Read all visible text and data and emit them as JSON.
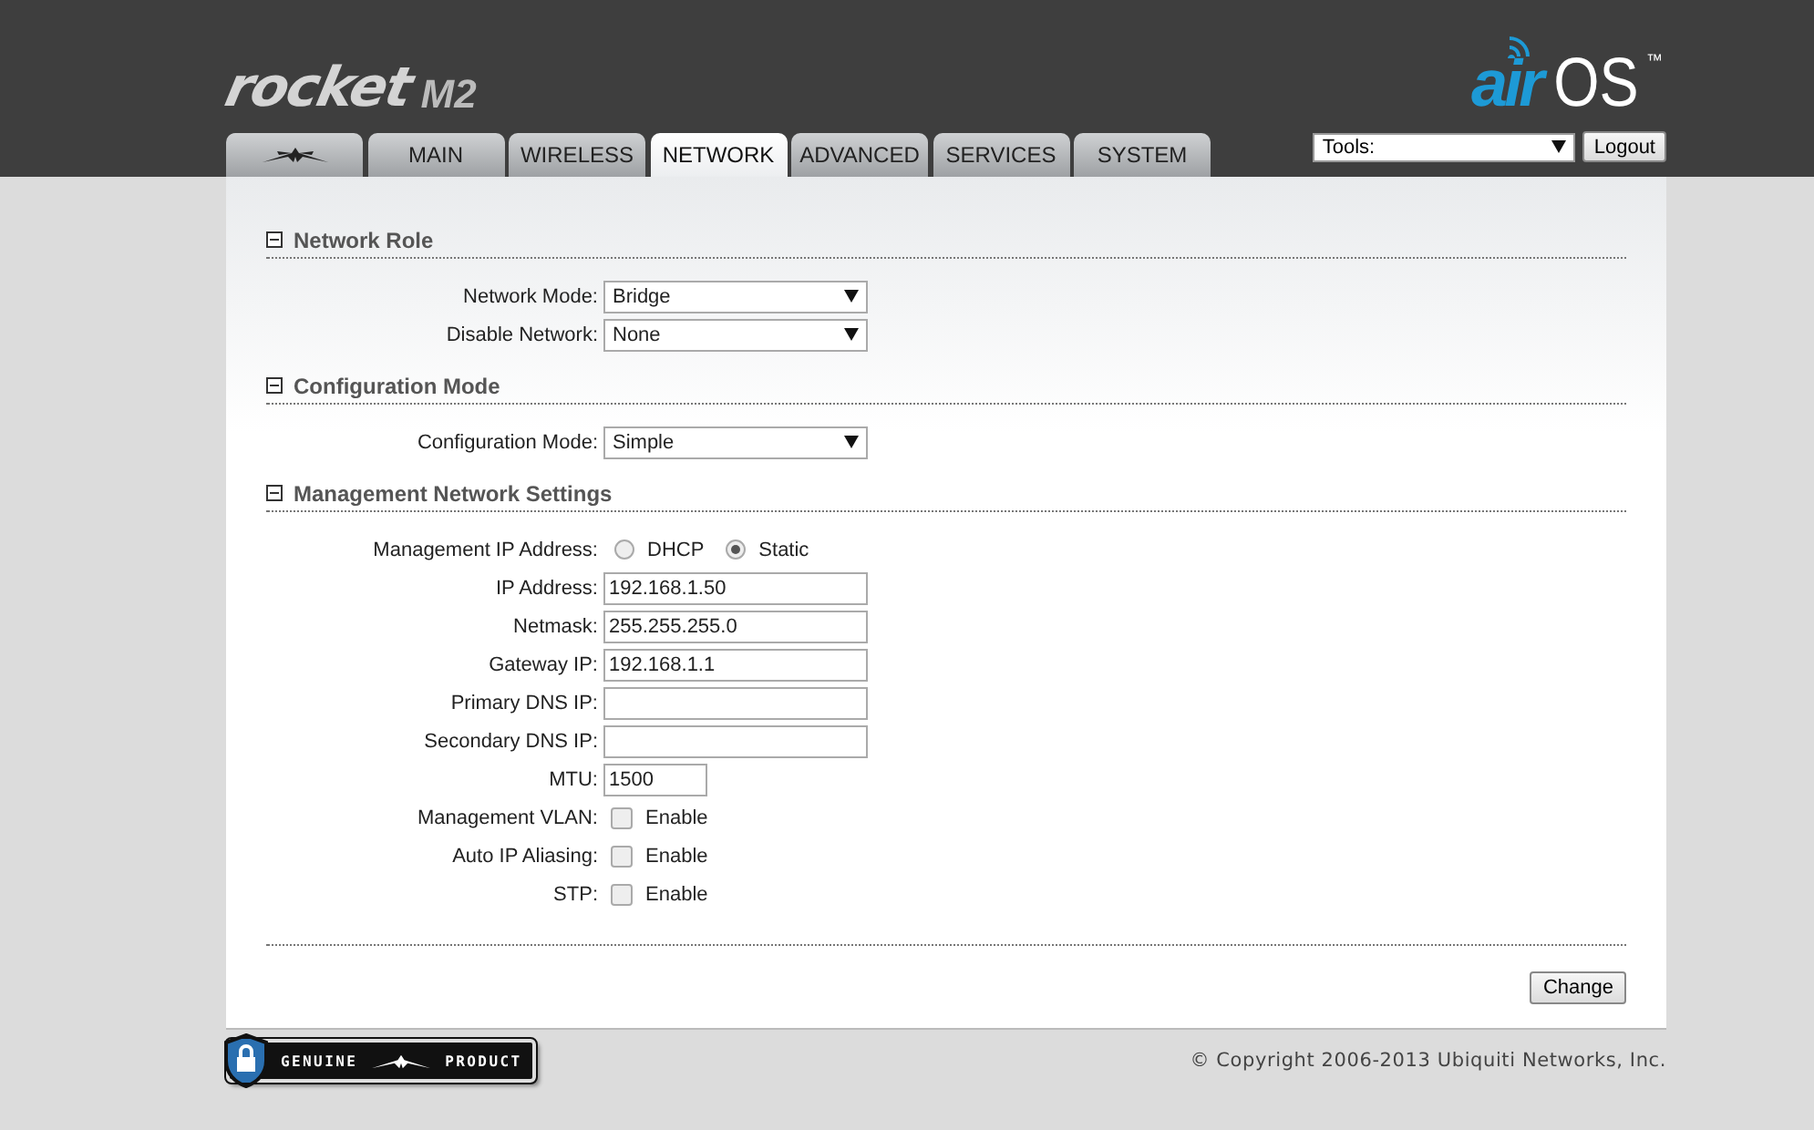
{
  "header": {
    "product_logo": {
      "name": "rocket",
      "model": "M2"
    },
    "os_logo": {
      "air": "air",
      "os": "OS",
      "tm": "™"
    }
  },
  "tabs": [
    {
      "kind": "icon",
      "selected": false
    },
    {
      "kind": "text",
      "label": "MAIN",
      "selected": false
    },
    {
      "kind": "text",
      "label": "WIRELESS",
      "selected": false
    },
    {
      "kind": "text",
      "label": "NETWORK",
      "selected": true
    },
    {
      "kind": "text",
      "label": "ADVANCED",
      "selected": false
    },
    {
      "kind": "text",
      "label": "SERVICES",
      "selected": false
    },
    {
      "kind": "text",
      "label": "SYSTEM",
      "selected": false
    }
  ],
  "tools": {
    "value": "Tools:"
  },
  "logout": "Logout",
  "sections": [
    {
      "title": "Network Role",
      "expanded": true,
      "fields": [
        {
          "kind": "select",
          "label": "Network Mode:",
          "value": "Bridge"
        },
        {
          "kind": "select",
          "label": "Disable Network:",
          "value": "None"
        }
      ]
    },
    {
      "title": "Configuration Mode",
      "expanded": true,
      "fields": [
        {
          "kind": "select",
          "label": "Configuration Mode:",
          "value": "Simple"
        }
      ]
    },
    {
      "title": "Management Network Settings",
      "expanded": true,
      "fields": [
        {
          "kind": "radio",
          "label": "Management IP Address:",
          "options": [
            {
              "label": "DHCP",
              "selected": false
            },
            {
              "label": "Static",
              "selected": true
            }
          ]
        },
        {
          "kind": "text",
          "label": "IP Address:",
          "value": "192.168.1.50"
        },
        {
          "kind": "text",
          "label": "Netmask:",
          "value": "255.255.255.0"
        },
        {
          "kind": "text",
          "label": "Gateway IP:",
          "value": "192.168.1.1"
        },
        {
          "kind": "text",
          "label": "Primary DNS IP:"
        },
        {
          "kind": "text",
          "label": "Secondary DNS IP:"
        },
        {
          "kind": "number",
          "label": "MTU:",
          "value": "1500"
        },
        {
          "kind": "checkbox",
          "label": "Management VLAN:",
          "option": "Enable",
          "checked": false
        },
        {
          "kind": "checkbox",
          "label": "Auto IP Aliasing:",
          "option": "Enable",
          "checked": false
        },
        {
          "kind": "checkbox",
          "label": "STP:",
          "option": "Enable",
          "checked": false
        }
      ]
    }
  ],
  "buttons": [
    "Change"
  ],
  "footer": {
    "badge": {
      "left": "GENUINE",
      "right": "PRODUCT"
    },
    "copyright": "© Copyright 2006-2013 Ubiquiti Networks, Inc."
  }
}
